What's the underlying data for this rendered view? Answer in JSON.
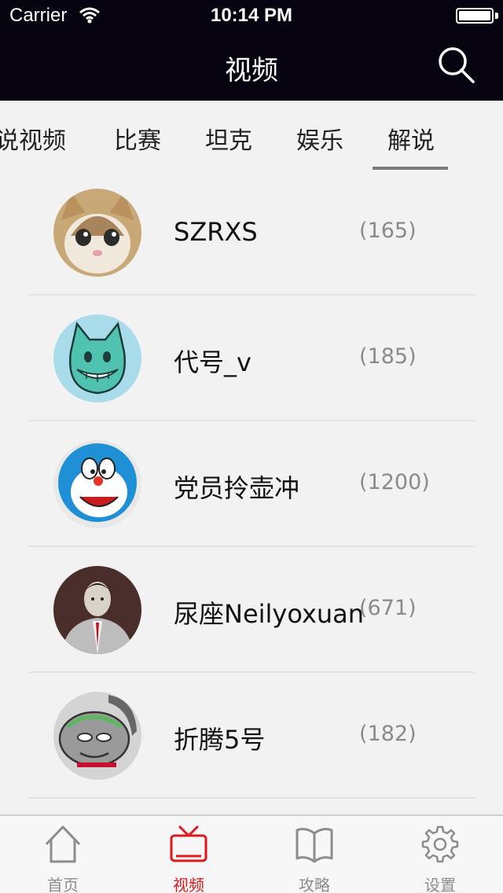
{
  "status_bar": {
    "carrier": "Carrier",
    "time": "10:14 PM"
  },
  "nav": {
    "title": "视频",
    "search_icon": "search-icon"
  },
  "tabs": [
    {
      "label": "说视频"
    },
    {
      "label": "比赛"
    },
    {
      "label": "坦克"
    },
    {
      "label": "娱乐"
    },
    {
      "label": "解说",
      "selected": true
    }
  ],
  "list": [
    {
      "name": "SZRXS",
      "count": "(165)",
      "avatar": "cat-photo-avatar"
    },
    {
      "name": "代号_v",
      "count": "(185)",
      "avatar": "cartoon-cat-avatar"
    },
    {
      "name": "党员拎壶冲",
      "count": "(1200)",
      "avatar": "doraemon-avatar"
    },
    {
      "name": "尿座Neilyoxuan",
      "count": "(671)",
      "avatar": "man-in-suit-avatar"
    },
    {
      "name": "折腾5号",
      "count": "(182)",
      "avatar": "cartoon-character-avatar"
    }
  ],
  "tabbar": [
    {
      "label": "首页",
      "icon": "home-icon"
    },
    {
      "label": "视频",
      "icon": "tv-icon",
      "active": true
    },
    {
      "label": "攻略",
      "icon": "book-icon"
    },
    {
      "label": "设置",
      "icon": "gear-icon"
    }
  ],
  "colors": {
    "nav_bg": "#07020f",
    "active_tab": "#e0171b",
    "background": "#f2f2f2",
    "indicator": "#7a7a7a"
  }
}
